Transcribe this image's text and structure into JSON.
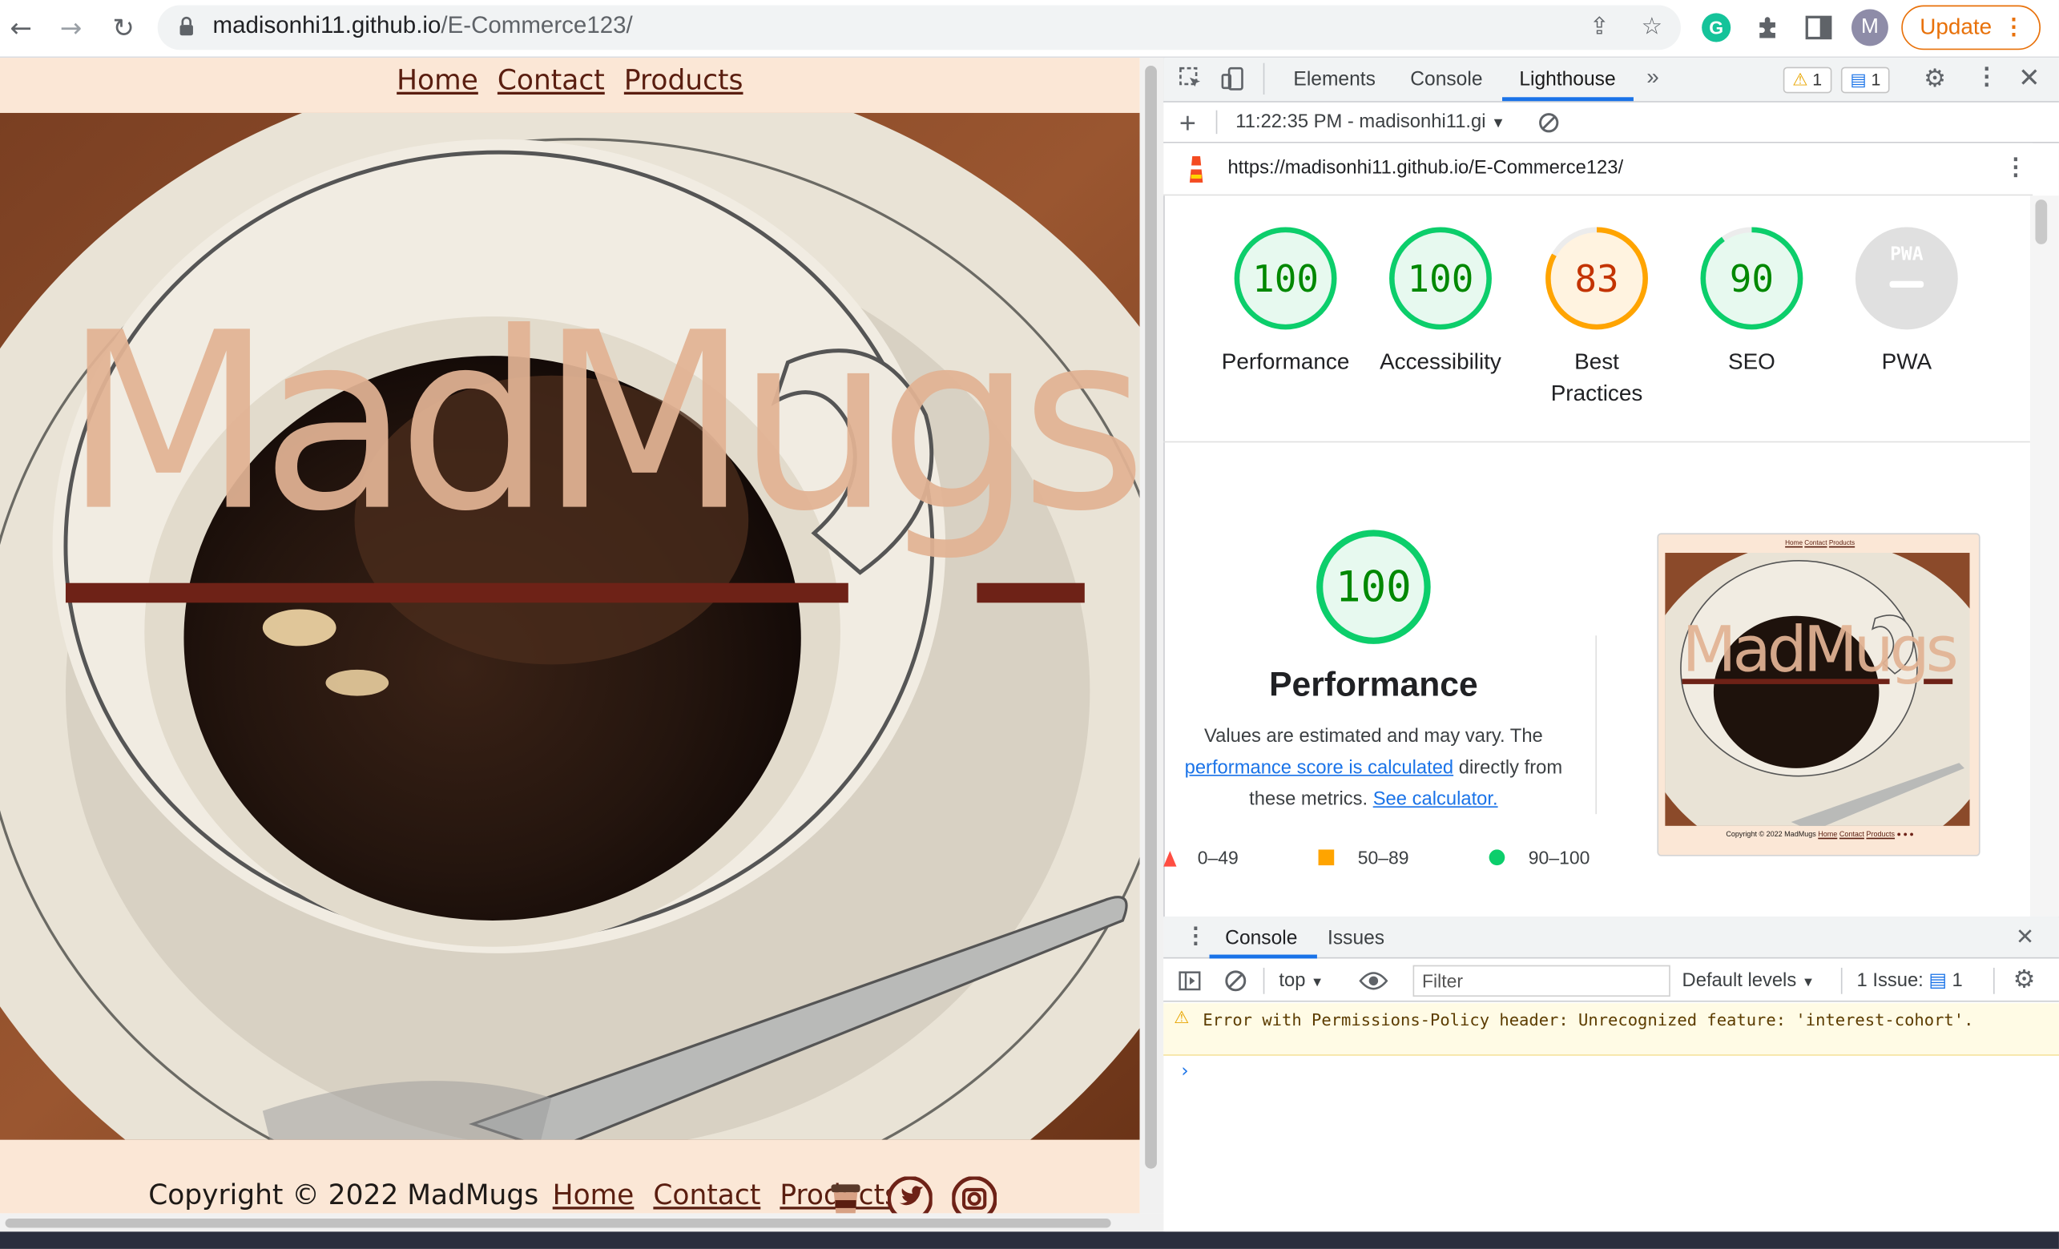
{
  "browser": {
    "url_host": "madisonhi11.github.io",
    "url_path": "/E-Commerce123/",
    "avatar_letter": "M",
    "update_label": "Update"
  },
  "site": {
    "nav": [
      "Home",
      "Contact",
      "Products"
    ],
    "brand": "MadMugs",
    "footer": {
      "copyright": "Copyright © 2022 MadMugs",
      "links": [
        "Home",
        "Contact",
        "Products"
      ]
    }
  },
  "devtools": {
    "tabs": [
      "Elements",
      "Console",
      "Lighthouse"
    ],
    "active_tab": "Lighthouse",
    "warning_count": "1",
    "message_count": "1",
    "report_select": "11:22:35 PM - madisonhi11.gi",
    "report_url": "https://madisonhi11.github.io/E-Commerce123/",
    "scores": [
      {
        "label": "Performance",
        "value": "100",
        "score": 100,
        "color": "#0cce6b",
        "text_color": "#008800"
      },
      {
        "label": "Accessibility",
        "value": "100",
        "score": 100,
        "color": "#0cce6b",
        "text_color": "#008800"
      },
      {
        "label": "Best Practices",
        "value": "83",
        "score": 83,
        "color": "#ffa400",
        "text_color": "#c33300"
      },
      {
        "label": "SEO",
        "value": "90",
        "score": 90,
        "color": "#0cce6b",
        "text_color": "#008800"
      },
      {
        "label": "PWA",
        "value": "PWA",
        "score": 0,
        "color": "#e0e0e0",
        "text_color": "#a0a0a0"
      }
    ],
    "performance": {
      "score": "100",
      "title": "Performance",
      "desc_prefix": "Values are estimated and may vary. The",
      "desc_link": "performance score is calculated",
      "desc_mid": "directly from these metrics.",
      "desc_link2": "See calculator."
    },
    "legend": [
      "0–49",
      "50–89",
      "90–100"
    ],
    "thumbnail": {
      "nav": [
        "Home",
        "Contact",
        "Products"
      ],
      "brand": "MadMugs",
      "footer": "Copyright © 2022 MadMugs",
      "footer_links": [
        "Home",
        "Contact",
        "Products"
      ]
    },
    "console": {
      "tabs": [
        "Console",
        "Issues"
      ],
      "context": "top",
      "filter_placeholder": "Filter",
      "levels": "Default levels",
      "issues_label": "1 Issue:",
      "issues_count": "1",
      "warning": "Error with Permissions-Policy header: Unrecognized feature: 'interest-cohort'.",
      "prompt": "›"
    }
  }
}
